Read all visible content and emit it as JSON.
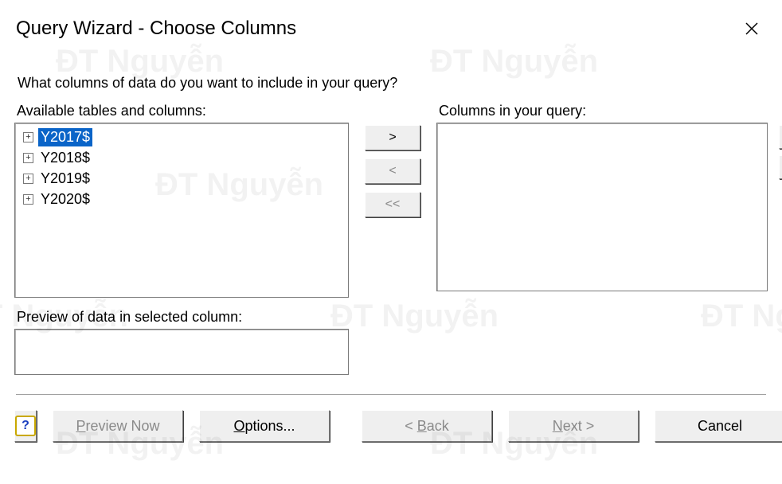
{
  "window": {
    "title": "Query Wizard - Choose Columns"
  },
  "labels": {
    "prompt": "What columns of data do you want to include in your query?",
    "available": "Available tables and columns:",
    "inQuery": "Columns in your query:",
    "preview": "Preview of data in selected column:"
  },
  "tables": [
    {
      "name": "Y2017$",
      "selected": true
    },
    {
      "name": "Y2018$",
      "selected": false
    },
    {
      "name": "Y2019$",
      "selected": false
    },
    {
      "name": "Y2020$",
      "selected": false
    }
  ],
  "transferButtons": {
    "addOne": ">",
    "removeOne": "<",
    "removeAll": "<<"
  },
  "footer": {
    "previewNow": "Preview Now",
    "options": "Options...",
    "back": "< Back",
    "next": "Next >",
    "cancel": "Cancel"
  },
  "watermark": "ĐT Nguyễn"
}
